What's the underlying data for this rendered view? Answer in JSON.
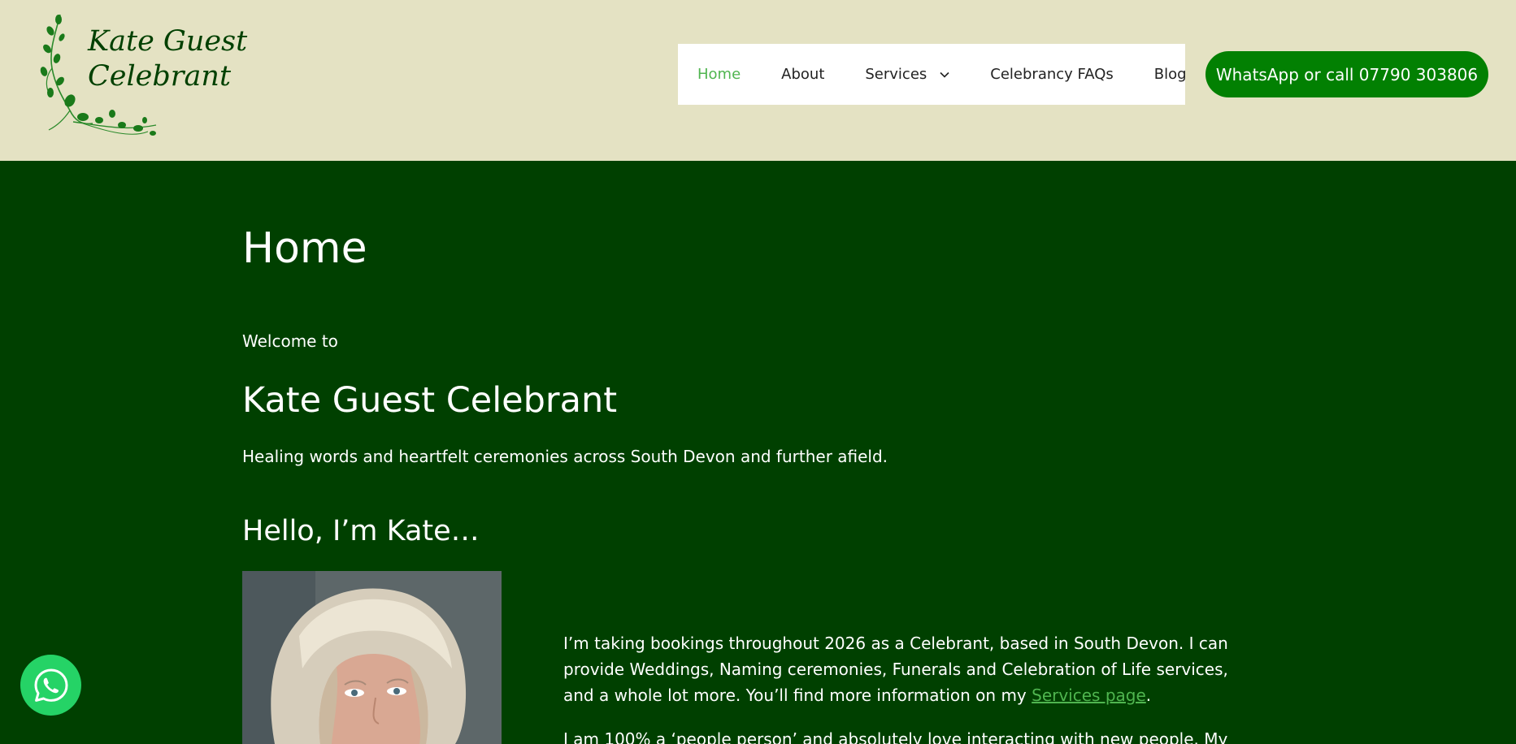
{
  "logo": {
    "line1": "Kate Guest",
    "line2": "Celebrant",
    "icon": "vine-leaves-logo"
  },
  "nav": {
    "items": [
      {
        "label": "Home",
        "active": true
      },
      {
        "label": "About",
        "active": false
      },
      {
        "label": "Services",
        "active": false,
        "has_dropdown": true
      },
      {
        "label": "Celebrancy FAQs",
        "active": false
      },
      {
        "label": "Blog",
        "active": false
      }
    ]
  },
  "cta": {
    "label": "WhatsApp or call 07790 303806"
  },
  "main": {
    "page_title": "Home",
    "welcome": "Welcome to",
    "brand_heading": "Kate Guest Celebrant",
    "tagline": "Healing words and heartfelt ceremonies across South Devon and further afield.",
    "hello_heading": "Hello, I’m Kate…",
    "intro_before_link": "I’m taking bookings throughout 2026 as a Celebrant, based in South Devon. I can provide Weddings, Naming ceremonies, Funerals and Celebration of Life services, and a whole lot more. You’ll find more information on my ",
    "intro_link": "Services page",
    "intro_after_link": ".",
    "intro_second": "I am 100% a ‘people person’ and absolutely love interacting with new people. My"
  },
  "colors": {
    "header_bg": "#e4e2c3",
    "page_bg": "#004000",
    "accent": "#4fb54f",
    "cta_bg": "#028002",
    "whatsapp": "#25d366"
  },
  "icons": {
    "whatsapp": "whatsapp-icon",
    "chevron": "chevron-down-icon"
  }
}
